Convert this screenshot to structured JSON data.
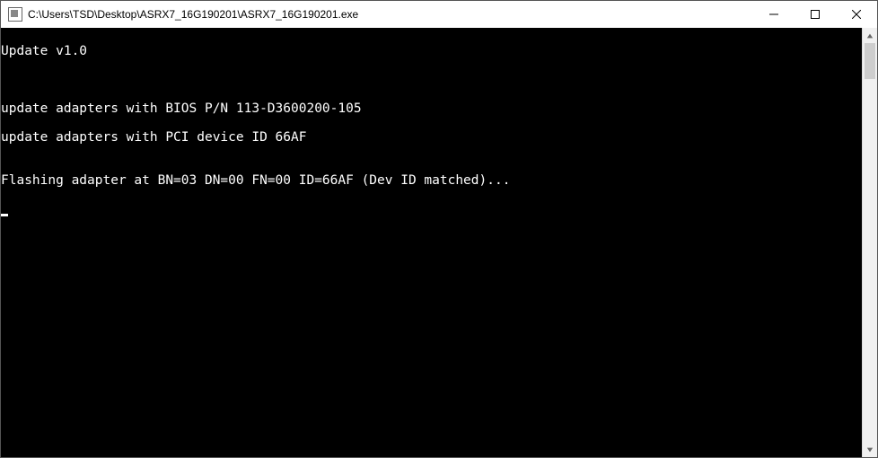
{
  "window": {
    "title": "C:\\Users\\TSD\\Desktop\\ASRX7_16G190201\\ASRX7_16G190201.exe"
  },
  "console": {
    "lines": [
      "Update v1.0",
      "",
      "",
      "update adapters with BIOS P/N 113-D3600200-105",
      "update adapters with PCI device ID 66AF",
      "",
      "Flashing adapter at BN=03 DN=00 FN=00 ID=66AF (Dev ID matched)..."
    ]
  }
}
